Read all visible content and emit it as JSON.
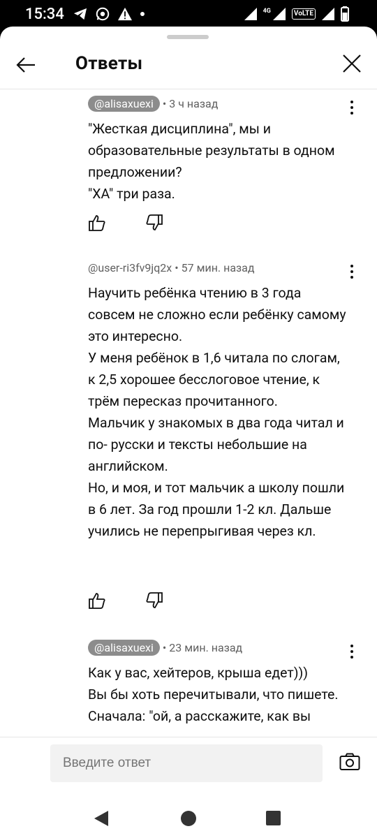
{
  "status_bar": {
    "time": "15:34",
    "network": "4G",
    "volte": "VoLTE"
  },
  "header": {
    "title": "Ответы"
  },
  "comments": [
    {
      "author": "@alisaxuexi",
      "time": "3 ч назад",
      "text": "\"Жесткая дисциплина\", мы и образовательные результаты в одном предложении?\n\"ХА\" три раза."
    },
    {
      "author": "@user-ri3fv9jq2x",
      "time": "57 мин. назад",
      "text": "Научить ребёнка чтению в 3 года совсем не сложно если ребёнку самому это интересно.\nУ меня ребёнок в 1,6 читала по слогам, к 2,5 хорошее бесслоговое чтение, к трём пересказ прочитанного.\nМальчик у знакомых в два года читал и по- русски и тексты небольшие на английском.\nНо, и моя, и тот мальчик а школу пошли в 6 лет. За год прошли 1-2 кл. Дальше учились не перепрыгивая через кл."
    },
    {
      "author": "@alisaxuexi",
      "time": "23 мин. назад",
      "text": "Как у вас, хейтеров, крыша едет)))\nВы бы хоть перечитывали, что пишете.\nСначала: \"ой, а расскажите, как вы"
    }
  ],
  "reply": {
    "placeholder": "Введите ответ"
  },
  "dot_separator": "•"
}
